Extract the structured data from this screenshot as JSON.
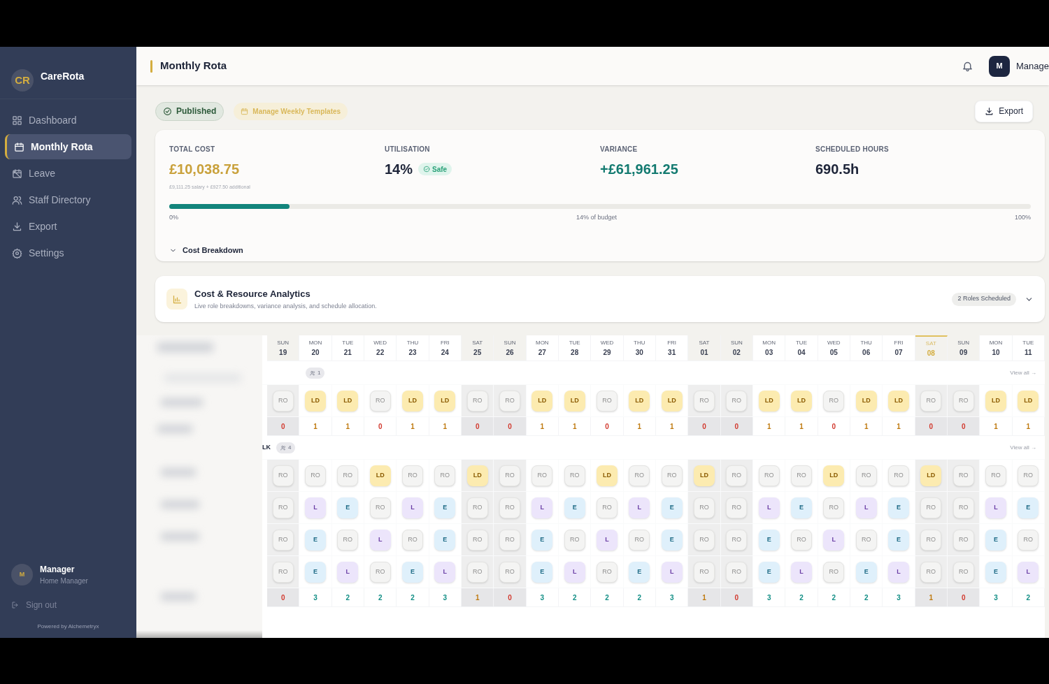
{
  "brand": {
    "initials": "CR",
    "name": "CareRota"
  },
  "sidebar": {
    "items": [
      {
        "label": "Dashboard",
        "selected": false
      },
      {
        "label": "Monthly Rota",
        "selected": true
      },
      {
        "label": "Leave",
        "selected": false
      },
      {
        "label": "Staff Directory",
        "selected": false
      },
      {
        "label": "Export",
        "selected": false
      },
      {
        "label": "Settings",
        "selected": false
      }
    ],
    "user": {
      "initial": "M",
      "name": "Manager",
      "role": "Home Manager"
    },
    "sign_out": "Sign out",
    "powered_by": "Powered by Alchemetryx"
  },
  "header": {
    "title": "Monthly Rota",
    "avatar": "M",
    "user": "Manage"
  },
  "toolbar": {
    "status": "Published",
    "templates": "Manage Weekly Templates",
    "export": "Export"
  },
  "stats": {
    "total_cost": {
      "label": "TOTAL COST",
      "value": "£10,038.75",
      "note": "£9,111.25 salary + £927.50 additional"
    },
    "utilisation": {
      "label": "UTILISATION",
      "value": "14%",
      "badge": "Safe"
    },
    "variance": {
      "label": "VARIANCE",
      "value": "+£61,961.25"
    },
    "scheduled_hours": {
      "label": "SCHEDULED HOURS",
      "value": "690.5h"
    },
    "budget": {
      "level": 0.14,
      "min": "0%",
      "caption": "14% of budget",
      "max": "100%"
    },
    "breakdown": {
      "label": "Cost Breakdown",
      "expanded": false
    }
  },
  "analytics": {
    "title": "Cost & Resource Analytics",
    "subtitle": "Live role breakdowns, variance analysis, and schedule allocation.",
    "badge": "2 Roles Scheduled",
    "expanded": false
  },
  "days": [
    {
      "dow": "SUN",
      "date": "19",
      "weekend": true,
      "today": false
    },
    {
      "dow": "MON",
      "date": "20",
      "weekend": false,
      "today": false
    },
    {
      "dow": "TUE",
      "date": "21",
      "weekend": false,
      "today": false
    },
    {
      "dow": "WED",
      "date": "22",
      "weekend": false,
      "today": false
    },
    {
      "dow": "THU",
      "date": "23",
      "weekend": false,
      "today": false
    },
    {
      "dow": "FRI",
      "date": "24",
      "weekend": false,
      "today": false
    },
    {
      "dow": "SAT",
      "date": "25",
      "weekend": true,
      "today": false
    },
    {
      "dow": "SUN",
      "date": "26",
      "weekend": true,
      "today": false
    },
    {
      "dow": "MON",
      "date": "27",
      "weekend": false,
      "today": false
    },
    {
      "dow": "TUE",
      "date": "28",
      "weekend": false,
      "today": false
    },
    {
      "dow": "WED",
      "date": "29",
      "weekend": false,
      "today": false
    },
    {
      "dow": "THU",
      "date": "30",
      "weekend": false,
      "today": false
    },
    {
      "dow": "FRI",
      "date": "31",
      "weekend": false,
      "today": false
    },
    {
      "dow": "SAT",
      "date": "01",
      "weekend": true,
      "today": false
    },
    {
      "dow": "SUN",
      "date": "02",
      "weekend": true,
      "today": false
    },
    {
      "dow": "MON",
      "date": "03",
      "weekend": false,
      "today": false
    },
    {
      "dow": "TUE",
      "date": "04",
      "weekend": false,
      "today": false
    },
    {
      "dow": "WED",
      "date": "05",
      "weekend": false,
      "today": false
    },
    {
      "dow": "THU",
      "date": "06",
      "weekend": false,
      "today": false
    },
    {
      "dow": "FRI",
      "date": "07",
      "weekend": false,
      "today": false
    },
    {
      "dow": "SAT",
      "date": "08",
      "weekend": true,
      "today": true
    },
    {
      "dow": "SUN",
      "date": "09",
      "weekend": true,
      "today": false
    },
    {
      "dow": "MON",
      "date": "10",
      "weekend": false,
      "today": false
    },
    {
      "dow": "TUE",
      "date": "11",
      "weekend": false,
      "today": false
    }
  ],
  "groups": [
    {
      "count": "1",
      "view_all": "View all →",
      "rows": [
        [
          {
            "code": "RO",
            "kind": "rest"
          },
          {
            "code": "LD",
            "kind": "long"
          },
          {
            "code": "LD",
            "kind": "long"
          },
          {
            "code": "RO",
            "kind": "rest"
          },
          {
            "code": "LD",
            "kind": "long"
          },
          {
            "code": "LD",
            "kind": "long"
          },
          {
            "code": "RO",
            "kind": "rest"
          },
          {
            "code": "RO",
            "kind": "rest"
          },
          {
            "code": "LD",
            "kind": "long"
          },
          {
            "code": "LD",
            "kind": "long"
          },
          {
            "code": "RO",
            "kind": "rest"
          },
          {
            "code": "LD",
            "kind": "long"
          },
          {
            "code": "LD",
            "kind": "long"
          },
          {
            "code": "RO",
            "kind": "rest"
          },
          {
            "code": "RO",
            "kind": "rest"
          },
          {
            "code": "LD",
            "kind": "long"
          },
          {
            "code": "LD",
            "kind": "long"
          },
          {
            "code": "RO",
            "kind": "rest"
          },
          {
            "code": "LD",
            "kind": "long"
          },
          {
            "code": "LD",
            "kind": "long"
          },
          {
            "code": "RO",
            "kind": "rest"
          },
          {
            "code": "RO",
            "kind": "rest"
          },
          {
            "code": "LD",
            "kind": "long"
          },
          {
            "code": "LD",
            "kind": "long"
          }
        ]
      ],
      "totals": [
        {
          "value": "0",
          "kind": "short"
        },
        {
          "value": "1",
          "kind": "low"
        },
        {
          "value": "1",
          "kind": "low"
        },
        {
          "value": "0",
          "kind": "short"
        },
        {
          "value": "1",
          "kind": "low"
        },
        {
          "value": "1",
          "kind": "low"
        },
        {
          "value": "0",
          "kind": "short"
        },
        {
          "value": "0",
          "kind": "short"
        },
        {
          "value": "1",
          "kind": "low"
        },
        {
          "value": "1",
          "kind": "low"
        },
        {
          "value": "0",
          "kind": "short"
        },
        {
          "value": "1",
          "kind": "low"
        },
        {
          "value": "1",
          "kind": "low"
        },
        {
          "value": "0",
          "kind": "short"
        },
        {
          "value": "0",
          "kind": "short"
        },
        {
          "value": "1",
          "kind": "low"
        },
        {
          "value": "1",
          "kind": "low"
        },
        {
          "value": "0",
          "kind": "short"
        },
        {
          "value": "1",
          "kind": "low"
        },
        {
          "value": "1",
          "kind": "low"
        },
        {
          "value": "0",
          "kind": "short"
        },
        {
          "value": "0",
          "kind": "short"
        },
        {
          "value": "1",
          "kind": "low"
        },
        {
          "value": "1",
          "kind": "low"
        }
      ]
    },
    {
      "label": "LK",
      "count": "4",
      "view_all": "View all →",
      "rows": [
        [
          {
            "code": "RO",
            "kind": "rest"
          },
          {
            "code": "RO",
            "kind": "rest"
          },
          {
            "code": "RO",
            "kind": "rest"
          },
          {
            "code": "LD",
            "kind": "long"
          },
          {
            "code": "RO",
            "kind": "rest"
          },
          {
            "code": "RO",
            "kind": "rest"
          },
          {
            "code": "LD",
            "kind": "long"
          },
          {
            "code": "RO",
            "kind": "rest"
          },
          {
            "code": "RO",
            "kind": "rest"
          },
          {
            "code": "RO",
            "kind": "rest"
          },
          {
            "code": "LD",
            "kind": "long"
          },
          {
            "code": "RO",
            "kind": "rest"
          },
          {
            "code": "RO",
            "kind": "rest"
          },
          {
            "code": "LD",
            "kind": "long"
          },
          {
            "code": "RO",
            "kind": "rest"
          },
          {
            "code": "RO",
            "kind": "rest"
          },
          {
            "code": "RO",
            "kind": "rest"
          },
          {
            "code": "LD",
            "kind": "long"
          },
          {
            "code": "RO",
            "kind": "rest"
          },
          {
            "code": "RO",
            "kind": "rest"
          },
          {
            "code": "LD",
            "kind": "long"
          },
          {
            "code": "RO",
            "kind": "rest"
          },
          {
            "code": "RO",
            "kind": "rest"
          },
          {
            "code": "RO",
            "kind": "rest"
          }
        ],
        [
          {
            "code": "RO",
            "kind": "rest"
          },
          {
            "code": "L",
            "kind": "late"
          },
          {
            "code": "E",
            "kind": "early"
          },
          {
            "code": "RO",
            "kind": "rest"
          },
          {
            "code": "L",
            "kind": "late"
          },
          {
            "code": "E",
            "kind": "early"
          },
          {
            "code": "RO",
            "kind": "rest"
          },
          {
            "code": "RO",
            "kind": "rest"
          },
          {
            "code": "L",
            "kind": "late"
          },
          {
            "code": "E",
            "kind": "early"
          },
          {
            "code": "RO",
            "kind": "rest"
          },
          {
            "code": "L",
            "kind": "late"
          },
          {
            "code": "E",
            "kind": "early"
          },
          {
            "code": "RO",
            "kind": "rest"
          },
          {
            "code": "RO",
            "kind": "rest"
          },
          {
            "code": "L",
            "kind": "late"
          },
          {
            "code": "E",
            "kind": "early"
          },
          {
            "code": "RO",
            "kind": "rest"
          },
          {
            "code": "L",
            "kind": "late"
          },
          {
            "code": "E",
            "kind": "early"
          },
          {
            "code": "RO",
            "kind": "rest"
          },
          {
            "code": "RO",
            "kind": "rest"
          },
          {
            "code": "L",
            "kind": "late"
          },
          {
            "code": "E",
            "kind": "early"
          }
        ],
        [
          {
            "code": "RO",
            "kind": "rest"
          },
          {
            "code": "E",
            "kind": "early"
          },
          {
            "code": "RO",
            "kind": "rest"
          },
          {
            "code": "L",
            "kind": "late"
          },
          {
            "code": "RO",
            "kind": "rest"
          },
          {
            "code": "E",
            "kind": "early"
          },
          {
            "code": "RO",
            "kind": "rest"
          },
          {
            "code": "RO",
            "kind": "rest"
          },
          {
            "code": "E",
            "kind": "early"
          },
          {
            "code": "RO",
            "kind": "rest"
          },
          {
            "code": "L",
            "kind": "late"
          },
          {
            "code": "RO",
            "kind": "rest"
          },
          {
            "code": "E",
            "kind": "early"
          },
          {
            "code": "RO",
            "kind": "rest"
          },
          {
            "code": "RO",
            "kind": "rest"
          },
          {
            "code": "E",
            "kind": "early"
          },
          {
            "code": "RO",
            "kind": "rest"
          },
          {
            "code": "L",
            "kind": "late"
          },
          {
            "code": "RO",
            "kind": "rest"
          },
          {
            "code": "E",
            "kind": "early"
          },
          {
            "code": "RO",
            "kind": "rest"
          },
          {
            "code": "RO",
            "kind": "rest"
          },
          {
            "code": "E",
            "kind": "early"
          },
          {
            "code": "RO",
            "kind": "rest"
          }
        ],
        [
          {
            "code": "RO",
            "kind": "rest"
          },
          {
            "code": "E",
            "kind": "early"
          },
          {
            "code": "L",
            "kind": "late"
          },
          {
            "code": "RO",
            "kind": "rest"
          },
          {
            "code": "E",
            "kind": "early"
          },
          {
            "code": "L",
            "kind": "late"
          },
          {
            "code": "RO",
            "kind": "rest"
          },
          {
            "code": "RO",
            "kind": "rest"
          },
          {
            "code": "E",
            "kind": "early"
          },
          {
            "code": "L",
            "kind": "late"
          },
          {
            "code": "RO",
            "kind": "rest"
          },
          {
            "code": "E",
            "kind": "early"
          },
          {
            "code": "L",
            "kind": "late"
          },
          {
            "code": "RO",
            "kind": "rest"
          },
          {
            "code": "RO",
            "kind": "rest"
          },
          {
            "code": "E",
            "kind": "early"
          },
          {
            "code": "L",
            "kind": "late"
          },
          {
            "code": "RO",
            "kind": "rest"
          },
          {
            "code": "E",
            "kind": "early"
          },
          {
            "code": "L",
            "kind": "late"
          },
          {
            "code": "RO",
            "kind": "rest"
          },
          {
            "code": "RO",
            "kind": "rest"
          },
          {
            "code": "E",
            "kind": "early"
          },
          {
            "code": "L",
            "kind": "late"
          }
        ]
      ],
      "totals": [
        {
          "value": "0",
          "kind": "short"
        },
        {
          "value": "3",
          "kind": "ok"
        },
        {
          "value": "2",
          "kind": "ok"
        },
        {
          "value": "2",
          "kind": "ok"
        },
        {
          "value": "2",
          "kind": "ok"
        },
        {
          "value": "3",
          "kind": "ok"
        },
        {
          "value": "1",
          "kind": "low"
        },
        {
          "value": "0",
          "kind": "short"
        },
        {
          "value": "3",
          "kind": "ok"
        },
        {
          "value": "2",
          "kind": "ok"
        },
        {
          "value": "2",
          "kind": "ok"
        },
        {
          "value": "2",
          "kind": "ok"
        },
        {
          "value": "3",
          "kind": "ok"
        },
        {
          "value": "1",
          "kind": "low"
        },
        {
          "value": "0",
          "kind": "short"
        },
        {
          "value": "3",
          "kind": "ok"
        },
        {
          "value": "2",
          "kind": "ok"
        },
        {
          "value": "2",
          "kind": "ok"
        },
        {
          "value": "2",
          "kind": "ok"
        },
        {
          "value": "3",
          "kind": "ok"
        },
        {
          "value": "1",
          "kind": "low"
        },
        {
          "value": "0",
          "kind": "short"
        },
        {
          "value": "3",
          "kind": "ok"
        },
        {
          "value": "2",
          "kind": "ok"
        }
      ]
    }
  ]
}
